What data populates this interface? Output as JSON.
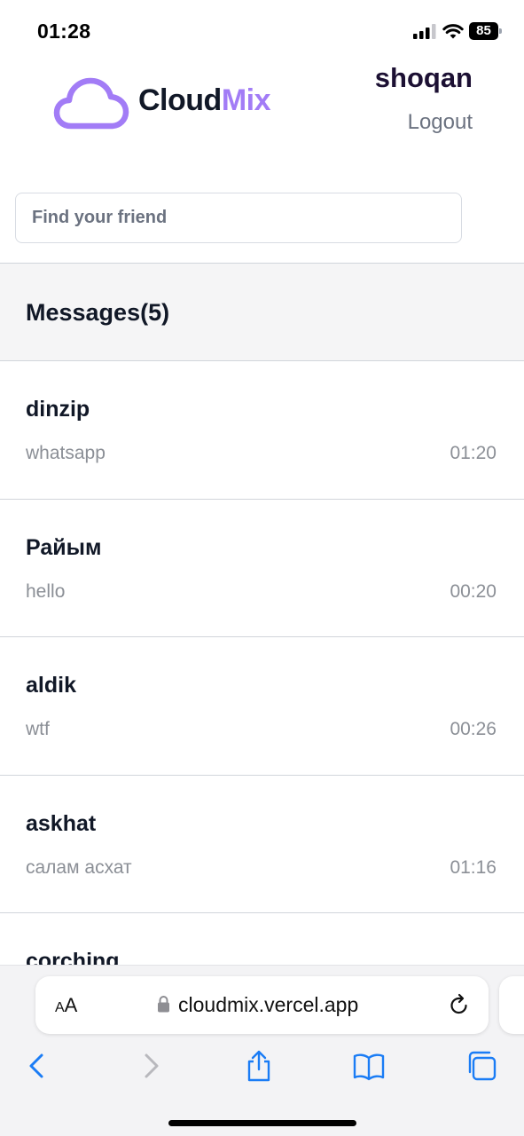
{
  "status_bar": {
    "time": "01:28",
    "battery": "85"
  },
  "header": {
    "logo_cloud": "Cloud",
    "logo_mix": "Mix",
    "username": "shoqan",
    "logout_label": "Logout"
  },
  "search": {
    "placeholder": "Find your friend"
  },
  "messages": {
    "title": "Messages(5)",
    "items": [
      {
        "name": "dinzip",
        "preview": "whatsapp",
        "time": "01:20"
      },
      {
        "name": "Райым",
        "preview": "hello",
        "time": "00:20"
      },
      {
        "name": "aldik",
        "preview": "wtf",
        "time": "00:26"
      },
      {
        "name": "askhat",
        "preview": "салам асхат",
        "time": "01:16"
      },
      {
        "name": "corching",
        "preview": "",
        "time": ""
      }
    ]
  },
  "browser": {
    "text_size_label_small": "A",
    "text_size_label_large": "A",
    "url": "cloudmix.vercel.app"
  },
  "colors": {
    "accent": "#a27cf6",
    "text": "#111827",
    "muted": "#8b8f96",
    "ios_blue": "#1a7cf5"
  },
  "icons": [
    "cellular-signal-icon",
    "wifi-icon",
    "battery-icon",
    "cloud-logo-icon",
    "lock-icon",
    "reload-icon",
    "back-icon",
    "forward-icon",
    "share-icon",
    "bookmarks-icon",
    "tabs-icon"
  ]
}
